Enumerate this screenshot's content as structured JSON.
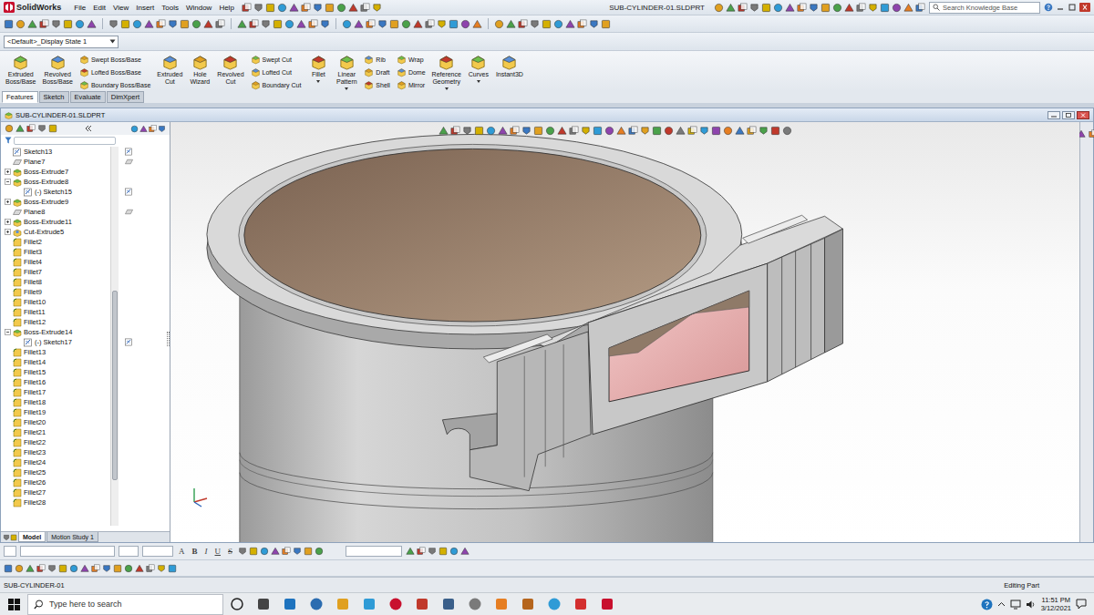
{
  "app": {
    "logo": "SolidWorks",
    "menus": [
      "File",
      "Edit",
      "View",
      "Insert",
      "Tools",
      "Window",
      "Help"
    ],
    "title": "SUB-CYLINDER-01.SLDPRT",
    "search": {
      "placeholder": "Search Knowledge Base"
    }
  },
  "display_state": "<Default>_Display State 1",
  "ribbon": [
    {
      "kind": "large",
      "lines": [
        "Extruded",
        "Boss/Base"
      ],
      "has_menu": false
    },
    {
      "kind": "large",
      "lines": [
        "Revolved",
        "Boss/Base"
      ],
      "has_menu": false
    },
    {
      "kind": "stack",
      "items": [
        "Swept Boss/Base",
        "Lofted Boss/Base",
        "Boundary Boss/Base"
      ]
    },
    {
      "kind": "large",
      "lines": [
        "Extruded",
        "Cut"
      ],
      "has_menu": false
    },
    {
      "kind": "large",
      "lines": [
        "Hole",
        "Wizard"
      ],
      "has_menu": false
    },
    {
      "kind": "large",
      "lines": [
        "Revolved",
        "Cut"
      ],
      "has_menu": false
    },
    {
      "kind": "stack",
      "items": [
        "Swept Cut",
        "Lofted Cut",
        "Boundary Cut"
      ]
    },
    {
      "kind": "large",
      "lines": [
        "Fillet"
      ],
      "has_menu": true
    },
    {
      "kind": "large",
      "lines": [
        "Linear",
        "Pattern"
      ],
      "has_menu": true
    },
    {
      "kind": "stack",
      "items": [
        "Rib",
        "Draft",
        "Shell"
      ]
    },
    {
      "kind": "stack",
      "items": [
        "Wrap",
        "Dome",
        "Mirror"
      ]
    },
    {
      "kind": "large",
      "lines": [
        "Reference",
        "Geometry"
      ],
      "has_menu": true
    },
    {
      "kind": "large",
      "lines": [
        "Curves"
      ],
      "has_menu": true
    },
    {
      "kind": "large",
      "lines": [
        "Instant3D"
      ],
      "has_menu": false
    }
  ],
  "tabs": [
    {
      "label": "Features",
      "selected": true
    },
    {
      "label": "Sketch",
      "selected": false
    },
    {
      "label": "Evaluate",
      "selected": false
    },
    {
      "label": "DimXpert",
      "selected": false
    }
  ],
  "document": {
    "title": "SUB-CYLINDER-01.SLDPRT"
  },
  "feature_tree": {
    "scrollbar": {
      "offset": 0.38,
      "size": 0.5
    },
    "items": [
      {
        "label": "Sketch13",
        "kind": "sketch",
        "depth": 0,
        "expandable": false,
        "expanded": false
      },
      {
        "label": "Plane7",
        "kind": "plane",
        "depth": 0,
        "expandable": false,
        "expanded": false
      },
      {
        "label": "Boss-Extrude7",
        "kind": "boss",
        "depth": 0,
        "expandable": true,
        "expanded": false
      },
      {
        "label": "Boss-Extrude8",
        "kind": "boss",
        "depth": 0,
        "expandable": true,
        "expanded": true
      },
      {
        "label": "(-) Sketch15",
        "kind": "sketch",
        "depth": 1,
        "expandable": false,
        "expanded": false
      },
      {
        "label": "Boss-Extrude9",
        "kind": "boss",
        "depth": 0,
        "expandable": true,
        "expanded": false
      },
      {
        "label": "Plane8",
        "kind": "plane",
        "depth": 0,
        "expandable": false,
        "expanded": false
      },
      {
        "label": "Boss-Extrude11",
        "kind": "boss",
        "depth": 0,
        "expandable": true,
        "expanded": false
      },
      {
        "label": "Cut-Extrude5",
        "kind": "cut",
        "depth": 0,
        "expandable": true,
        "expanded": false
      },
      {
        "label": "Fillet2",
        "kind": "fillet",
        "depth": 0,
        "expandable": false,
        "expanded": false
      },
      {
        "label": "Fillet3",
        "kind": "fillet",
        "depth": 0,
        "expandable": false,
        "expanded": false
      },
      {
        "label": "Fillet4",
        "kind": "fillet",
        "depth": 0,
        "expandable": false,
        "expanded": false
      },
      {
        "label": "Fillet7",
        "kind": "fillet",
        "depth": 0,
        "expandable": false,
        "expanded": false
      },
      {
        "label": "Fillet8",
        "kind": "fillet",
        "depth": 0,
        "expandable": false,
        "expanded": false
      },
      {
        "label": "Fillet9",
        "kind": "fillet",
        "depth": 0,
        "expandable": false,
        "expanded": false
      },
      {
        "label": "Fillet10",
        "kind": "fillet",
        "depth": 0,
        "expandable": false,
        "expanded": false
      },
      {
        "label": "Fillet11",
        "kind": "fillet",
        "depth": 0,
        "expandable": false,
        "expanded": false
      },
      {
        "label": "Fillet12",
        "kind": "fillet",
        "depth": 0,
        "expandable": false,
        "expanded": false
      },
      {
        "label": "Boss-Extrude14",
        "kind": "boss",
        "depth": 0,
        "expandable": true,
        "expanded": true
      },
      {
        "label": "(-) Sketch17",
        "kind": "sketch",
        "depth": 1,
        "expandable": false,
        "expanded": false
      },
      {
        "label": "Fillet13",
        "kind": "fillet",
        "depth": 0,
        "expandable": false,
        "expanded": false
      },
      {
        "label": "Fillet14",
        "kind": "fillet",
        "depth": 0,
        "expandable": false,
        "expanded": false
      },
      {
        "label": "Fillet15",
        "kind": "fillet",
        "depth": 0,
        "expandable": false,
        "expanded": false
      },
      {
        "label": "Fillet16",
        "kind": "fillet",
        "depth": 0,
        "expandable": false,
        "expanded": false
      },
      {
        "label": "Fillet17",
        "kind": "fillet",
        "depth": 0,
        "expandable": false,
        "expanded": false
      },
      {
        "label": "Fillet18",
        "kind": "fillet",
        "depth": 0,
        "expandable": false,
        "expanded": false
      },
      {
        "label": "Fillet19",
        "kind": "fillet",
        "depth": 0,
        "expandable": false,
        "expanded": false
      },
      {
        "label": "Fillet20",
        "kind": "fillet",
        "depth": 0,
        "expandable": false,
        "expanded": false
      },
      {
        "label": "Fillet21",
        "kind": "fillet",
        "depth": 0,
        "expandable": false,
        "expanded": false
      },
      {
        "label": "Fillet22",
        "kind": "fillet",
        "depth": 0,
        "expandable": false,
        "expanded": false
      },
      {
        "label": "Fillet23",
        "kind": "fillet",
        "depth": 0,
        "expandable": false,
        "expanded": false
      },
      {
        "label": "Fillet24",
        "kind": "fillet",
        "depth": 0,
        "expandable": false,
        "expanded": false
      },
      {
        "label": "Fillet25",
        "kind": "fillet",
        "depth": 0,
        "expandable": false,
        "expanded": false
      },
      {
        "label": "Fillet26",
        "kind": "fillet",
        "depth": 0,
        "expandable": false,
        "expanded": false
      },
      {
        "label": "Fillet27",
        "kind": "fillet",
        "depth": 0,
        "expandable": false,
        "expanded": false
      },
      {
        "label": "Fillet28",
        "kind": "fillet",
        "depth": 0,
        "expandable": false,
        "expanded": false
      }
    ]
  },
  "bottom_tabs": [
    {
      "label": "Model",
      "selected": true
    },
    {
      "label": "Motion Study 1",
      "selected": false
    }
  ],
  "format_buttons": [
    "A",
    "B",
    "I",
    "U",
    "S"
  ],
  "status_bar": {
    "left": "SUB-CYLINDER-01",
    "right": "Editing Part"
  },
  "taskbar": {
    "search_placeholder": "Type here to search",
    "time": "11:51 PM",
    "date": "3/12/2021"
  }
}
